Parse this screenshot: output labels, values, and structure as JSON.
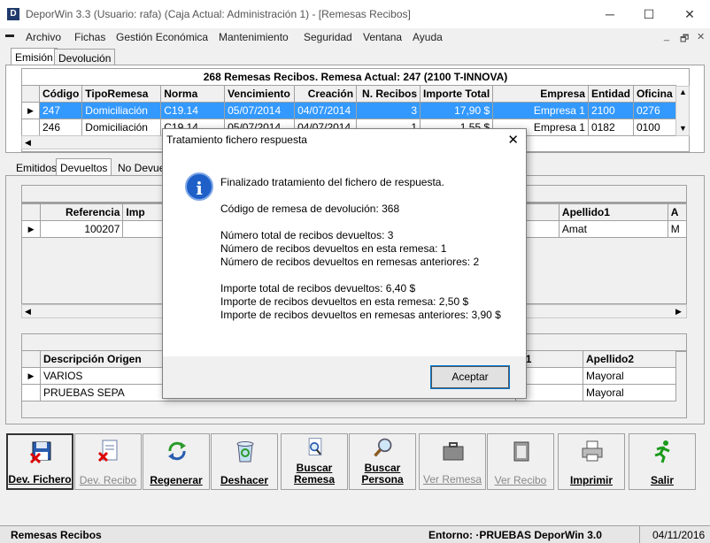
{
  "window": {
    "app_letter": "D",
    "title": "DeporWin 3.3  (Usuario: rafa)  (Caja Actual: Administración 1) - [Remesas Recibos]",
    "minimize": "─",
    "maximize": "☐",
    "close": "✕"
  },
  "menu": {
    "items": [
      "Archivo",
      "Fichas",
      "Gestión Económica",
      "Mantenimiento",
      "Seguridad",
      "Ventana",
      "Ayuda"
    ],
    "mdi_minimize": "_",
    "mdi_restore": "🗗",
    "mdi_close": "✕"
  },
  "top_tabs": [
    "Emisión",
    "Devolución"
  ],
  "remesas_grid": {
    "caption": "268 Remesas Recibos. Remesa Actual: 247  (2100  T-INNOVA)",
    "columns": [
      "Código",
      "TipoRemesa",
      "Norma",
      "Vencimiento",
      "Creación",
      "N. Recibos",
      "Importe Total",
      "Empresa",
      "Entidad",
      "Oficina"
    ],
    "rows": [
      [
        "247",
        "Domiciliación",
        "C19.14",
        "05/07/2014",
        "04/07/2014",
        "3",
        "17,90 $",
        "Empresa 1",
        "2100",
        "0276"
      ],
      [
        "246",
        "Domiciliación",
        "C19.14",
        "05/07/2014",
        "04/07/2014",
        "1",
        "1,55 $",
        "Empresa 1",
        "0182",
        "0100"
      ]
    ]
  },
  "sub_tabs": [
    "Emitidos",
    "Devueltos",
    "No Devue"
  ],
  "devueltos_grid": {
    "columns": [
      "Referencia",
      "Imp",
      "Apellido1",
      "A"
    ],
    "rows": [
      [
        "100207",
        "",
        "Amat",
        "M"
      ]
    ]
  },
  "origen_grid": {
    "columns": [
      "Descripción Origen",
      "o1",
      "Apellido2"
    ],
    "rows": [
      [
        "VARIOS",
        "",
        "Mayoral"
      ],
      [
        "PRUEBAS SEPA",
        "",
        "Mayoral"
      ]
    ]
  },
  "toolbar": [
    {
      "label": "Dev. Fichero",
      "icon": "floppy-x-icon",
      "enabled": true
    },
    {
      "label": "Dev. Recibo",
      "icon": "document-x-icon",
      "enabled": false
    },
    {
      "label": "Regenerar",
      "icon": "recycle-arrows-icon",
      "enabled": true
    },
    {
      "label": "Deshacer",
      "icon": "recycle-bin-icon",
      "enabled": true
    },
    {
      "label": "Buscar Remesa",
      "icon": "search-document-icon",
      "enabled": true
    },
    {
      "label": "Buscar Persona",
      "icon": "magnifier-icon",
      "enabled": true
    },
    {
      "label": "Ver Remesa",
      "icon": "briefcase-icon",
      "enabled": false
    },
    {
      "label": "Ver Recibo",
      "icon": "clipboard-icon",
      "enabled": false
    },
    {
      "label": "Imprimir",
      "icon": "printer-icon",
      "enabled": true
    },
    {
      "label": "Salir",
      "icon": "running-man-icon",
      "enabled": true
    }
  ],
  "status": {
    "left": "Remesas Recibos",
    "env": "Entorno: ·PRUEBAS DeporWin 3.0",
    "date": "04/11/2016"
  },
  "dialog": {
    "title": "Tratamiento fichero respuesta",
    "close": "✕",
    "icon_glyph": "i",
    "lines": [
      "Finalizado tratamiento del fichero de respuesta.",
      "Código de remesa de devolución: 368",
      "Número total de recibos devueltos: 3",
      "Número de recibos devueltos en esta remesa: 1",
      "Número de recibos devueltos en remesas anteriores: 2",
      "Importe total de recibos devueltos: 6,40 $",
      "Importe de recibos devueltos en esta remesa: 2,50 $",
      "Importe de recibos devueltos en remesas anteriores: 3,90 $"
    ],
    "ok_label": "Aceptar"
  },
  "colors": {
    "selection": "#3399ff",
    "info_icon": "#1e60c8"
  }
}
